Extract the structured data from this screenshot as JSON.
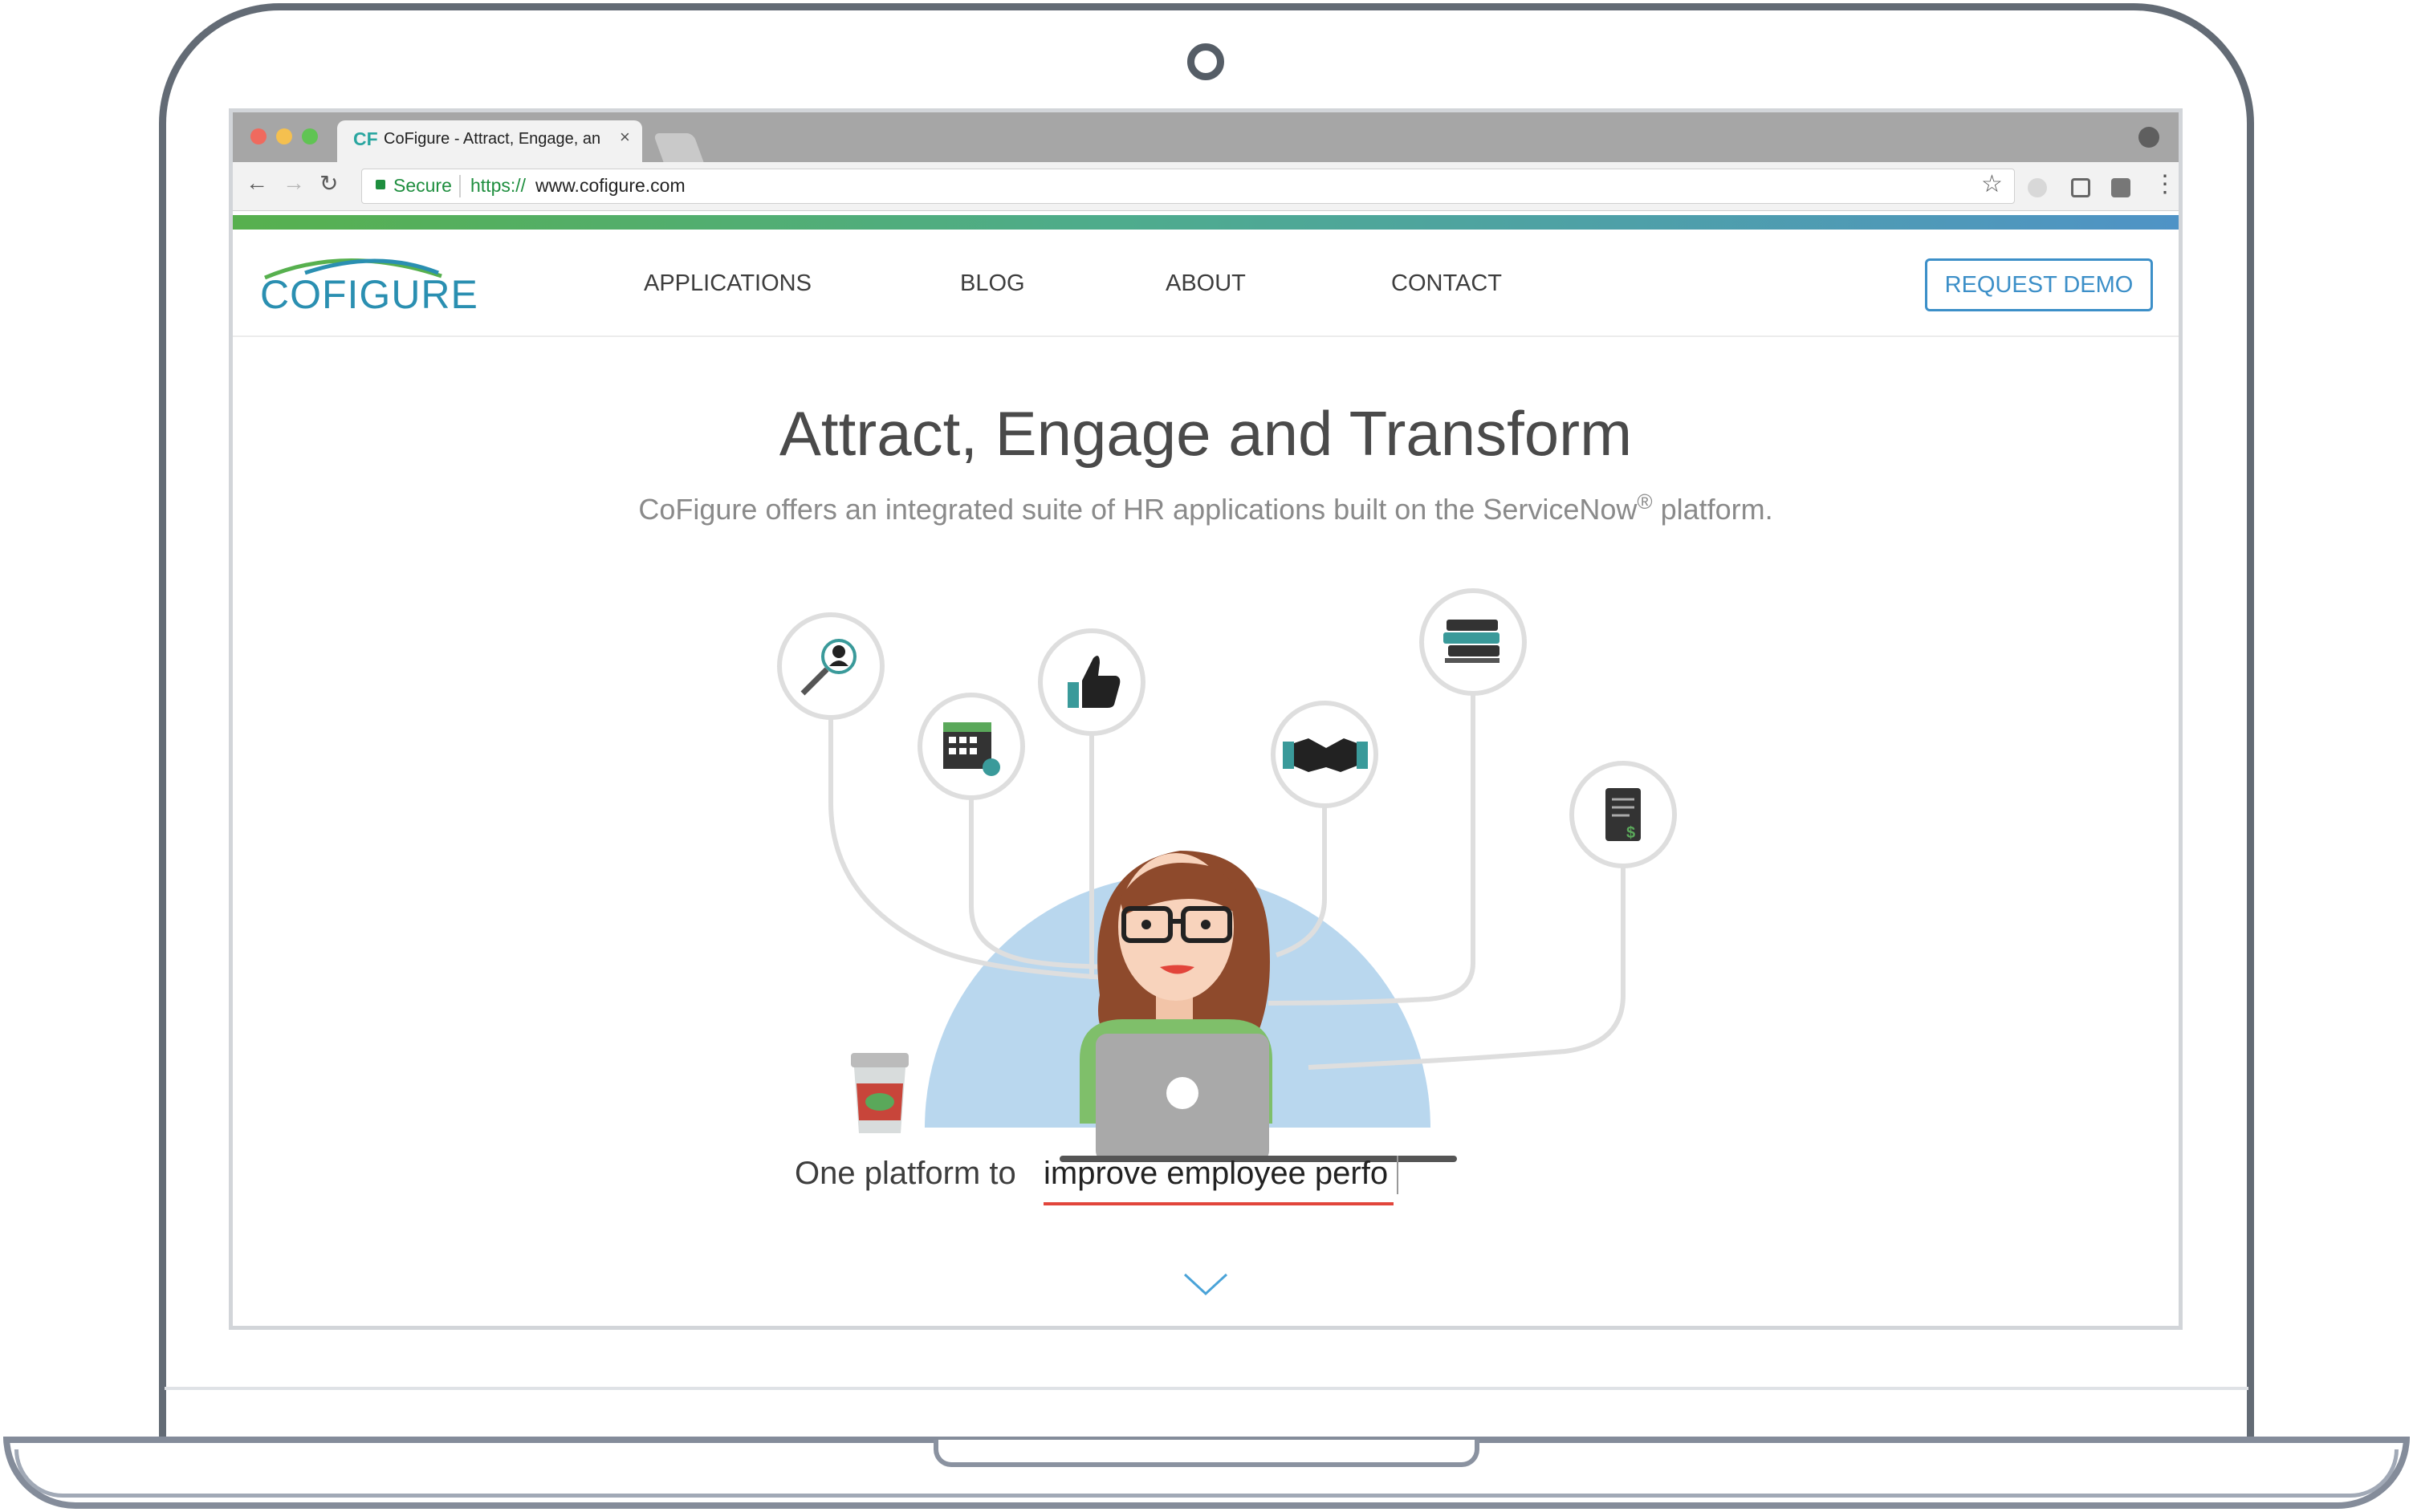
{
  "browser": {
    "tab_icon": "CF",
    "tab_title": "CoFigure - Attract, Engage, an",
    "tab_close": "×",
    "secure_label": "Secure",
    "url_scheme": "https://",
    "url_host": "www.cofigure.com"
  },
  "site": {
    "logo_text": "COFIGURE",
    "nav": [
      "APPLICATIONS",
      "BLOG",
      "ABOUT",
      "CONTACT"
    ],
    "cta": "REQUEST DEMO",
    "hero_title": "Attract, Engage and Transform",
    "hero_subtitle_pre": "CoFigure offers an integrated suite of HR applications built on the ServiceNow",
    "hero_subtitle_reg": "®",
    "hero_subtitle_post": " platform.",
    "tagline_prefix": "One platform to",
    "tagline_typed": "improve employee perfo"
  },
  "icons": [
    "search-person-icon",
    "calendar-icon",
    "thumbs-up-icon",
    "handshake-icon",
    "books-icon",
    "receipt-icon"
  ],
  "colors": {
    "brand_blue": "#2a8fb1",
    "brand_green": "#57b04e",
    "accent_red": "#e2453b",
    "hero_circle": "#b9d7ee"
  }
}
